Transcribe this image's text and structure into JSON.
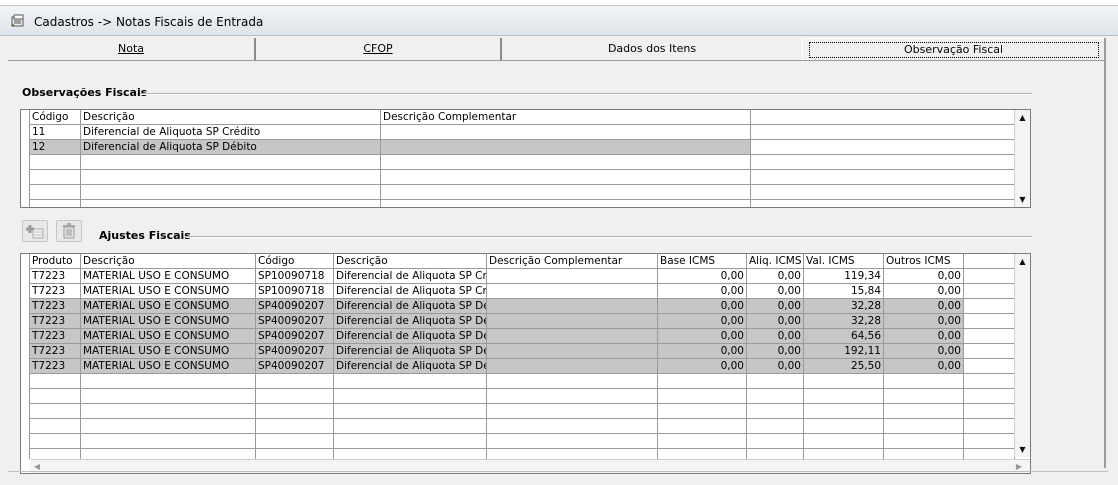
{
  "window": {
    "title": "Cadastros -> Notas Fiscais de Entrada"
  },
  "tabs": [
    {
      "label": "Nota",
      "active": false
    },
    {
      "label": "CFOP",
      "active": false
    },
    {
      "label": "Dados dos Itens",
      "active": false
    },
    {
      "label": "Observação Fiscal",
      "active": true
    }
  ],
  "observacoes": {
    "section_title": "Observações Fiscais",
    "columns": [
      "Código",
      "Descrição",
      "Descrição Complementar",
      ""
    ],
    "rows": [
      {
        "codigo": "11",
        "descricao": "Diferencial de Aliquota SP Crédito",
        "complementar": "",
        "selected": false
      },
      {
        "codigo": "12",
        "descricao": "Diferencial de Aliquota SP Débito",
        "complementar": "",
        "selected": true
      }
    ]
  },
  "ajustes": {
    "section_title": "Ajustes Fiscais",
    "toolbar": {
      "add_icon": "add-row-icon",
      "delete_icon": "trash-icon"
    },
    "columns": [
      "Produto",
      "Descrição",
      "Código",
      "Descrição",
      "Descrição Complementar",
      "Base ICMS",
      "Aliq. ICMS",
      "Val. ICMS",
      "Outros ICMS",
      ""
    ],
    "rows": [
      {
        "produto": "T7223",
        "descricao": "MATERIAL USO E CONSUMO",
        "codigo": "SP10090718",
        "descricao2": "Diferencial de Aliquota SP Crédi",
        "complementar": "",
        "base": "0,00",
        "aliq": "0,00",
        "val": "119,34",
        "outros": "0,00",
        "selected": false
      },
      {
        "produto": "T7223",
        "descricao": "MATERIAL USO E CONSUMO",
        "codigo": "SP10090718",
        "descricao2": "Diferencial de Aliquota SP Crédi",
        "complementar": "",
        "base": "0,00",
        "aliq": "0,00",
        "val": "15,84",
        "outros": "0,00",
        "selected": false
      },
      {
        "produto": "T7223",
        "descricao": "MATERIAL USO E CONSUMO",
        "codigo": "SP40090207",
        "descricao2": "Diferencial de Aliquota SP Débit",
        "complementar": "",
        "base": "0,00",
        "aliq": "0,00",
        "val": "32,28",
        "outros": "0,00",
        "selected": true
      },
      {
        "produto": "T7223",
        "descricao": "MATERIAL USO E CONSUMO",
        "codigo": "SP40090207",
        "descricao2": "Diferencial de Aliquota SP Débit",
        "complementar": "",
        "base": "0,00",
        "aliq": "0,00",
        "val": "32,28",
        "outros": "0,00",
        "selected": true
      },
      {
        "produto": "T7223",
        "descricao": "MATERIAL USO E CONSUMO",
        "codigo": "SP40090207",
        "descricao2": "Diferencial de Aliquota SP Débit",
        "complementar": "",
        "base": "0,00",
        "aliq": "0,00",
        "val": "64,56",
        "outros": "0,00",
        "selected": true
      },
      {
        "produto": "T7223",
        "descricao": "MATERIAL USO E CONSUMO",
        "codigo": "SP40090207",
        "descricao2": "Diferencial de Aliquota SP Débit",
        "complementar": "",
        "base": "0,00",
        "aliq": "0,00",
        "val": "192,11",
        "outros": "0,00",
        "selected": true
      },
      {
        "produto": "T7223",
        "descricao": "MATERIAL USO E CONSUMO",
        "codigo": "SP40090207",
        "descricao2": "Diferencial de Aliquota SP Débit",
        "complementar": "",
        "base": "0,00",
        "aliq": "0,00",
        "val": "25,50",
        "outros": "0,00",
        "selected": true
      }
    ]
  },
  "colors": {
    "selected_row": "#c6c6c6",
    "grid_line": "#9a9a9a"
  }
}
